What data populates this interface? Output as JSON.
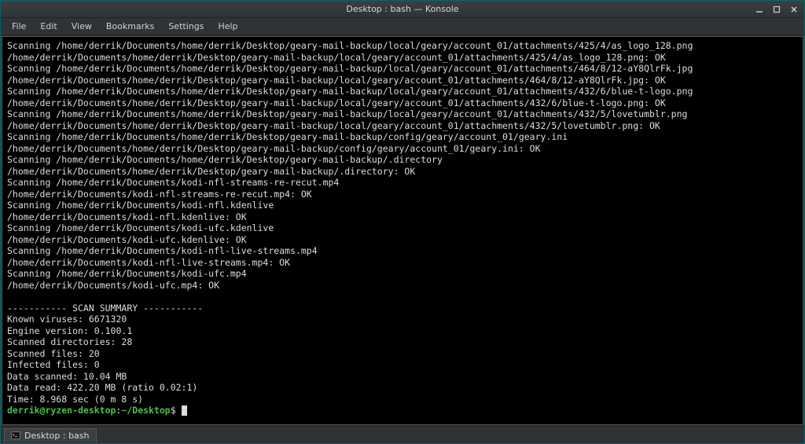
{
  "window": {
    "title": "Desktop : bash — Konsole"
  },
  "menubar": {
    "items": [
      "File",
      "Edit",
      "View",
      "Bookmarks",
      "Settings",
      "Help"
    ]
  },
  "tab": {
    "label": "Desktop : bash"
  },
  "terminal": {
    "lines": [
      "Scanning /home/derrik/Documents/home/derrik/Desktop/geary-mail-backup/local/geary/account_01/attachments/425/4/as_logo_128.png",
      "/home/derrik/Documents/home/derrik/Desktop/geary-mail-backup/local/geary/account_01/attachments/425/4/as_logo_128.png: OK",
      "Scanning /home/derrik/Documents/home/derrik/Desktop/geary-mail-backup/local/geary/account_01/attachments/464/8/12-aY8QlrFk.jpg",
      "/home/derrik/Documents/home/derrik/Desktop/geary-mail-backup/local/geary/account_01/attachments/464/8/12-aY8QlrFk.jpg: OK",
      "Scanning /home/derrik/Documents/home/derrik/Desktop/geary-mail-backup/local/geary/account_01/attachments/432/6/blue-t-logo.png",
      "/home/derrik/Documents/home/derrik/Desktop/geary-mail-backup/local/geary/account_01/attachments/432/6/blue-t-logo.png: OK",
      "Scanning /home/derrik/Documents/home/derrik/Desktop/geary-mail-backup/local/geary/account_01/attachments/432/5/lovetumblr.png",
      "/home/derrik/Documents/home/derrik/Desktop/geary-mail-backup/local/geary/account_01/attachments/432/5/lovetumblr.png: OK",
      "Scanning /home/derrik/Documents/home/derrik/Desktop/geary-mail-backup/config/geary/account_01/geary.ini",
      "/home/derrik/Documents/home/derrik/Desktop/geary-mail-backup/config/geary/account_01/geary.ini: OK",
      "Scanning /home/derrik/Documents/home/derrik/Desktop/geary-mail-backup/.directory",
      "/home/derrik/Documents/home/derrik/Desktop/geary-mail-backup/.directory: OK",
      "Scanning /home/derrik/Documents/kodi-nfl-streams-re-recut.mp4",
      "/home/derrik/Documents/kodi-nfl-streams-re-recut.mp4: OK",
      "Scanning /home/derrik/Documents/kodi-nfl.kdenlive",
      "/home/derrik/Documents/kodi-nfl.kdenlive: OK",
      "Scanning /home/derrik/Documents/kodi-ufc.kdenlive",
      "/home/derrik/Documents/kodi-ufc.kdenlive: OK",
      "Scanning /home/derrik/Documents/kodi-nfl-live-streams.mp4",
      "/home/derrik/Documents/kodi-nfl-live-streams.mp4: OK",
      "Scanning /home/derrik/Documents/kodi-ufc.mp4",
      "/home/derrik/Documents/kodi-ufc.mp4: OK",
      "",
      "----------- SCAN SUMMARY -----------",
      "Known viruses: 6671320",
      "Engine version: 0.100.1",
      "Scanned directories: 28",
      "Scanned files: 20",
      "Infected files: 0",
      "Data scanned: 10.04 MB",
      "Data read: 422.20 MB (ratio 0.02:1)",
      "Time: 8.968 sec (0 m 8 s)"
    ],
    "prompt": {
      "user": "derrik@ryzen-desktop",
      "sep": ":",
      "path": "~/Desktop",
      "symbol": "$"
    }
  }
}
